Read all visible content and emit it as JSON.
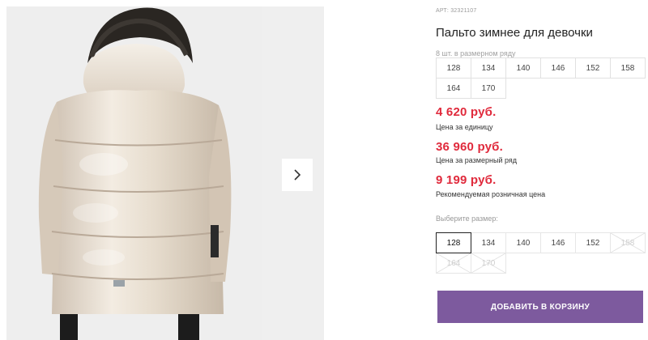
{
  "product": {
    "sku_label": "АРТ:",
    "sku": "32321107",
    "title": "Пальто зимнее для девочки"
  },
  "size_row": {
    "caption": "8 шт. в размерном ряду",
    "sizes": [
      "128",
      "134",
      "140",
      "146",
      "152",
      "158",
      "164",
      "170"
    ]
  },
  "prices": [
    {
      "value": "4 620 руб.",
      "caption": "Цена за единицу"
    },
    {
      "value": "36 960 руб.",
      "caption": "Цена за размерный ряд"
    },
    {
      "value": "9 199 руб.",
      "caption": "Рекомендуемая розничная цена"
    }
  ],
  "size_picker": {
    "caption": "Выберите размер:",
    "options": [
      {
        "label": "128",
        "state": "selected"
      },
      {
        "label": "134",
        "state": "available"
      },
      {
        "label": "140",
        "state": "available"
      },
      {
        "label": "146",
        "state": "available"
      },
      {
        "label": "152",
        "state": "available"
      },
      {
        "label": "158",
        "state": "unavailable"
      },
      {
        "label": "164",
        "state": "unavailable"
      },
      {
        "label": "170",
        "state": "unavailable"
      }
    ]
  },
  "cart_button_label": "ДОБАВИТЬ В КОРЗИНУ",
  "gallery": {
    "next_icon": "chevron-right-icon"
  },
  "colors": {
    "price": "#e02a3c",
    "button": "#7d5a9e",
    "coat": "#e8ddd0"
  }
}
